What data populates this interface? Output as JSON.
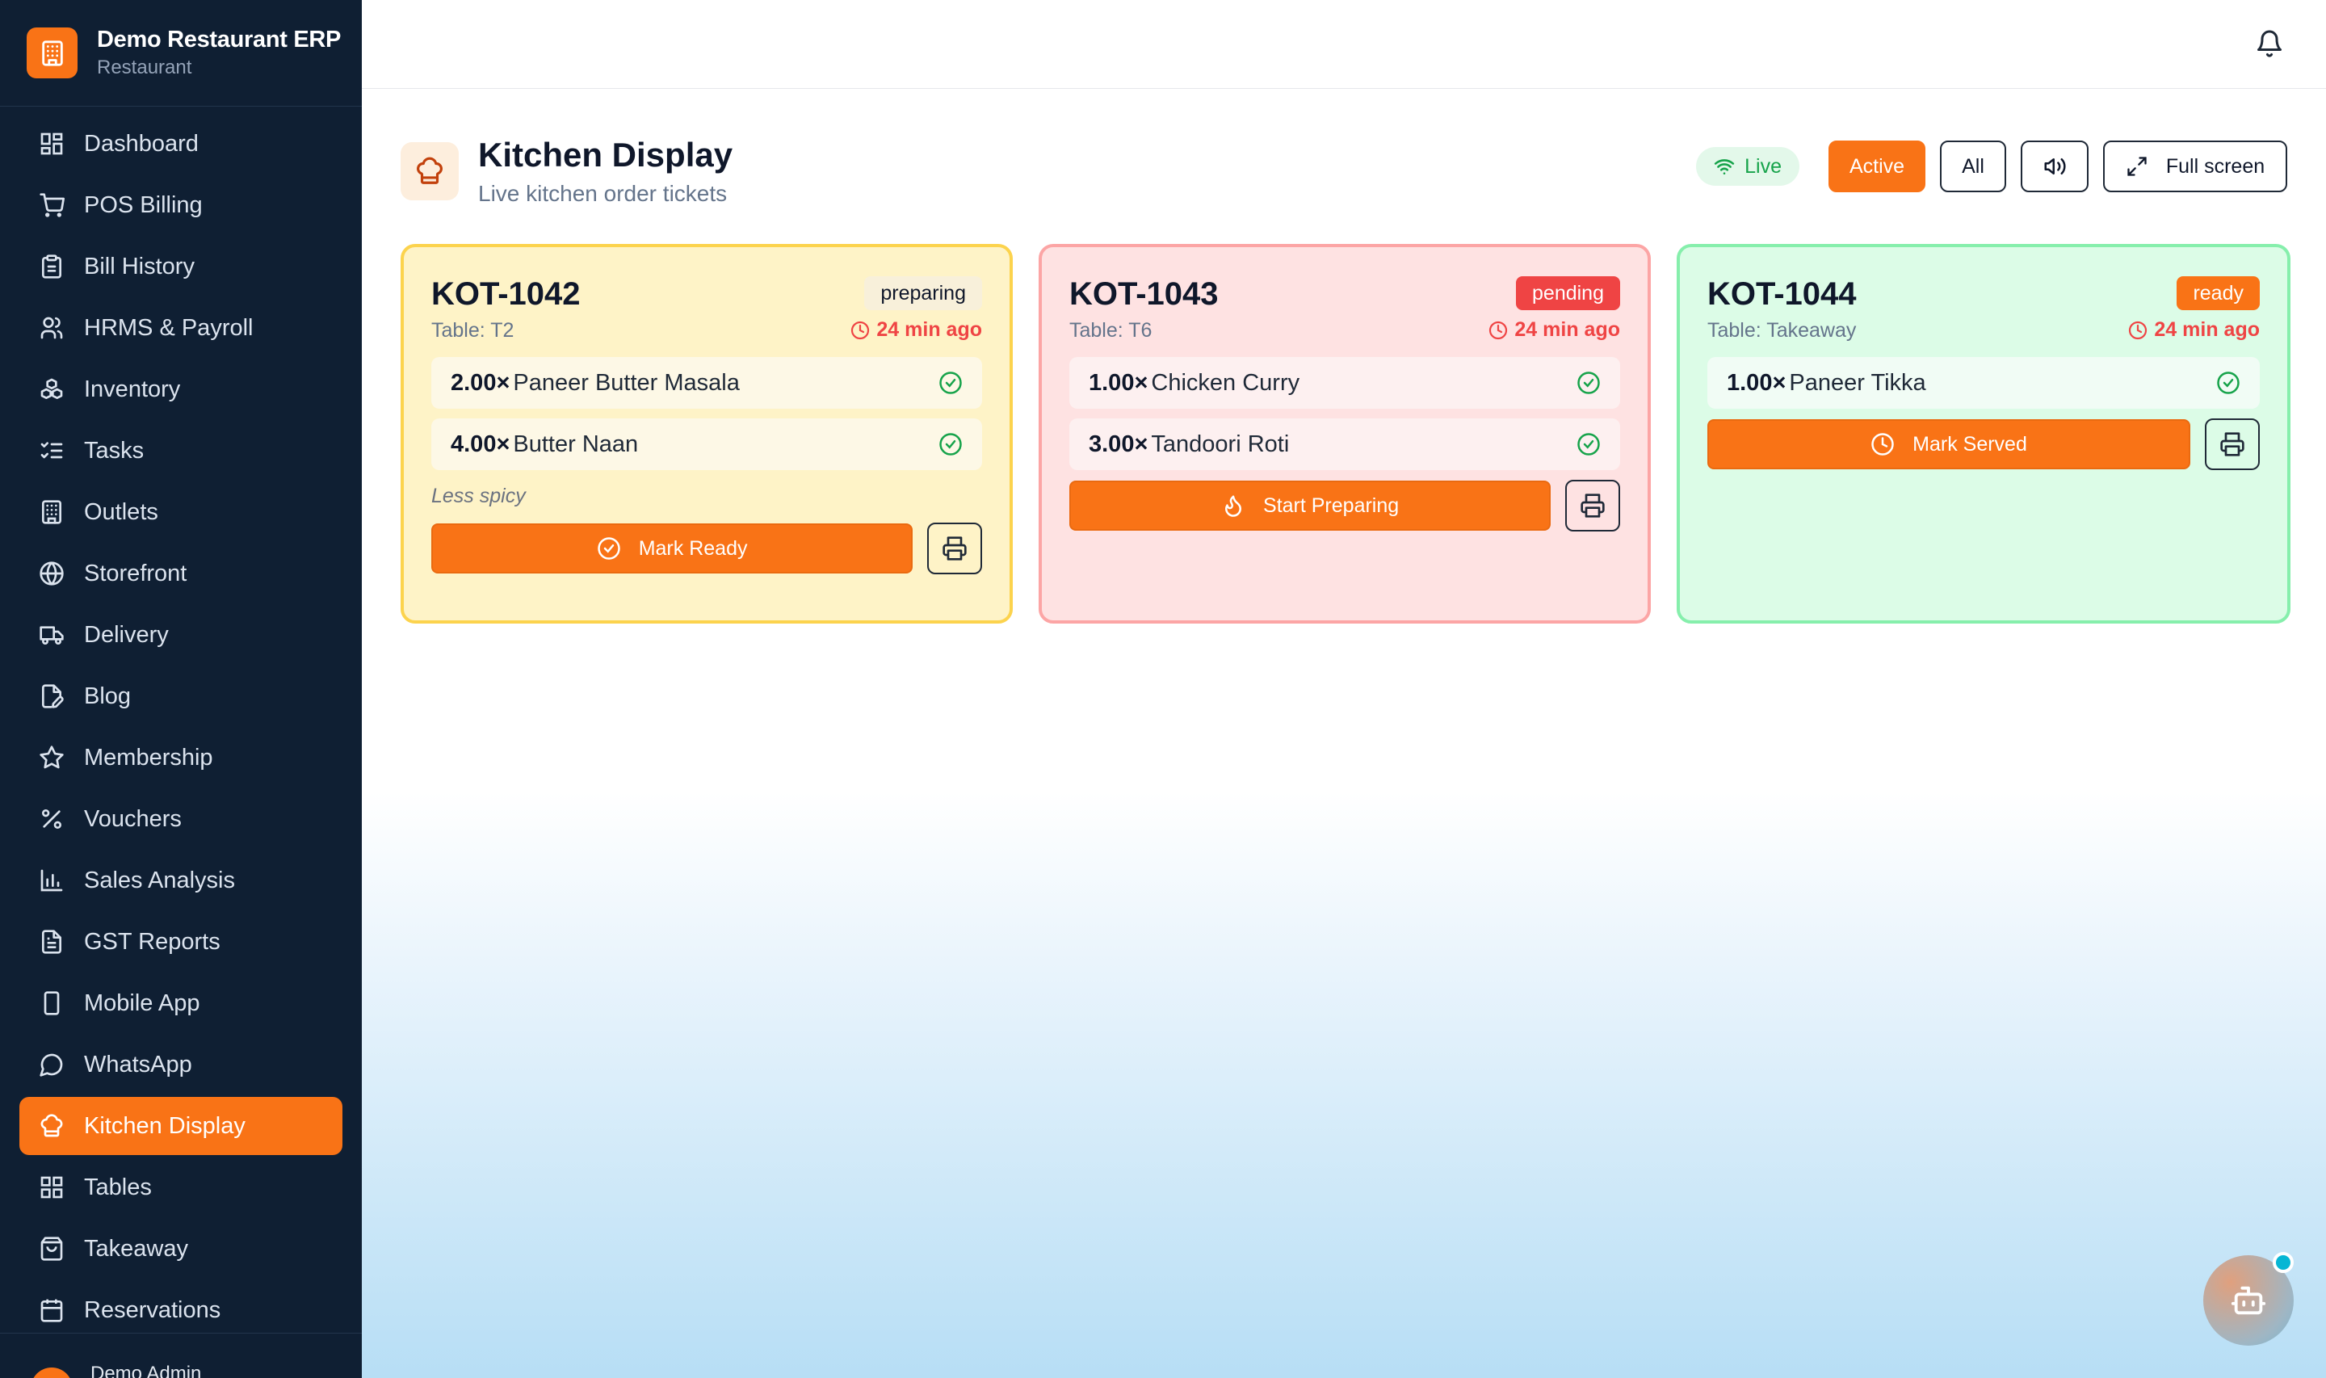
{
  "brand": {
    "name": "Demo Restaurant ERP",
    "subtitle": "Restaurant",
    "icon": "building-icon"
  },
  "sidebar": {
    "items": [
      {
        "label": "Dashboard",
        "icon": "grid-icon",
        "active": false
      },
      {
        "label": "POS Billing",
        "icon": "cart-icon",
        "active": false
      },
      {
        "label": "Bill History",
        "icon": "clipboard-icon",
        "active": false
      },
      {
        "label": "HRMS & Payroll",
        "icon": "users-icon",
        "active": false
      },
      {
        "label": "Inventory",
        "icon": "boxes-icon",
        "active": false
      },
      {
        "label": "Tasks",
        "icon": "checklist-icon",
        "active": false
      },
      {
        "label": "Outlets",
        "icon": "building-icon",
        "active": false
      },
      {
        "label": "Storefront",
        "icon": "globe-icon",
        "active": false
      },
      {
        "label": "Delivery",
        "icon": "truck-icon",
        "active": false
      },
      {
        "label": "Blog",
        "icon": "file-pen-icon",
        "active": false
      },
      {
        "label": "Membership",
        "icon": "star-icon",
        "active": false
      },
      {
        "label": "Vouchers",
        "icon": "percent-icon",
        "active": false
      },
      {
        "label": "Sales Analysis",
        "icon": "bar-chart-icon",
        "active": false
      },
      {
        "label": "GST Reports",
        "icon": "file-text-icon",
        "active": false
      },
      {
        "label": "Mobile App",
        "icon": "smartphone-icon",
        "active": false
      },
      {
        "label": "WhatsApp",
        "icon": "message-circle-icon",
        "active": false
      },
      {
        "label": "Kitchen Display",
        "icon": "chef-hat-icon",
        "active": true
      },
      {
        "label": "Tables",
        "icon": "grid-icon",
        "active": false
      },
      {
        "label": "Takeaway",
        "icon": "shopping-bag-icon",
        "active": false
      },
      {
        "label": "Reservations",
        "icon": "calendar-icon",
        "active": false
      }
    ],
    "user": {
      "name": "Demo Admin"
    }
  },
  "header": {
    "bell_icon": "bell-icon"
  },
  "page": {
    "title": "Kitchen Display",
    "subtitle": "Live kitchen order tickets",
    "icon": "chef-hat-icon"
  },
  "controls": {
    "live": "Live",
    "active": "Active",
    "all": "All",
    "sound_icon": "volume-icon",
    "fullscreen": "Full screen"
  },
  "tickets": [
    {
      "kot": "KOT-1042",
      "table": "Table: T2",
      "status": "preparing",
      "time": "24 min ago",
      "items": [
        {
          "qty": "2.00×",
          "name": "Paneer Butter Masala"
        },
        {
          "qty": "4.00×",
          "name": "Butter Naan"
        }
      ],
      "note": "Less spicy",
      "action": "Mark Ready"
    },
    {
      "kot": "KOT-1043",
      "table": "Table: T6",
      "status": "pending",
      "time": "24 min ago",
      "items": [
        {
          "qty": "1.00×",
          "name": "Chicken Curry"
        },
        {
          "qty": "3.00×",
          "name": "Tandoori Roti"
        }
      ],
      "action": "Start Preparing"
    },
    {
      "kot": "KOT-1044",
      "table": "Table: Takeaway",
      "status": "ready",
      "time": "24 min ago",
      "items": [
        {
          "qty": "1.00×",
          "name": "Paneer Tikka"
        }
      ],
      "action": "Mark Served"
    }
  ],
  "colors": {
    "accent": "#f97316",
    "sidebar_bg": "#0f1f33",
    "danger": "#ef4444",
    "success": "#16a34a"
  }
}
